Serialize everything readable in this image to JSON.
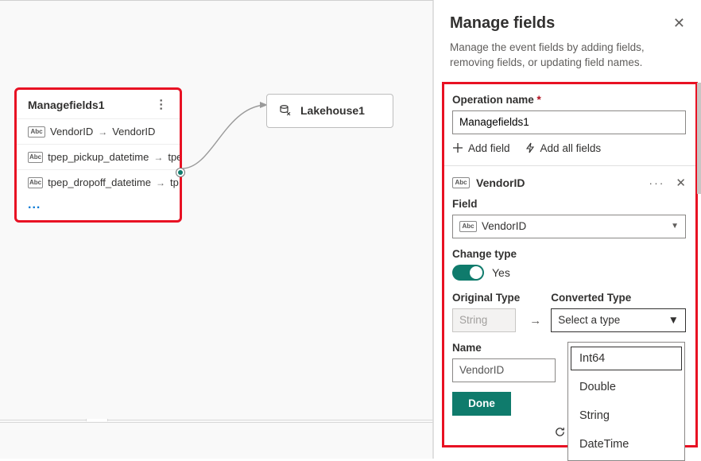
{
  "canvas": {
    "manage_node": {
      "title": "Managefields1",
      "rows": [
        {
          "src": "VendorID",
          "dst": "VendorID"
        },
        {
          "src": "tpep_pickup_datetime",
          "dst": "tpe"
        },
        {
          "src": "tpep_dropoff_datetime",
          "dst": "tp"
        }
      ]
    },
    "lakehouse_node": {
      "title": "Lakehouse1"
    }
  },
  "panel": {
    "title": "Manage fields",
    "subtitle": "Manage the event fields by adding fields, removing fields, or updating field names.",
    "operation_name_label": "Operation name",
    "operation_name_value": "Managefields1",
    "add_field": "Add field",
    "add_all": "Add all fields",
    "field_block": {
      "header_name": "VendorID",
      "field_label": "Field",
      "field_value": "VendorID",
      "change_type_label": "Change type",
      "change_type_yes": "Yes",
      "original_type_label": "Original Type",
      "original_type_value": "String",
      "converted_type_label": "Converted Type",
      "converted_type_placeholder": "Select a type",
      "name_label": "Name",
      "name_value": "VendorID",
      "done": "Done"
    },
    "footer_refresh": "Re",
    "dropdown": {
      "items": [
        "Int64",
        "Double",
        "String",
        "DateTime"
      ]
    }
  }
}
